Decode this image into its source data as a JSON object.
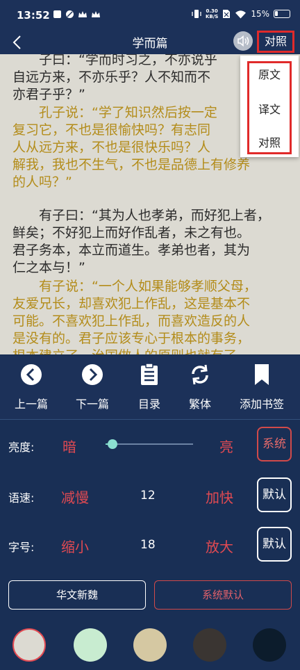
{
  "status": {
    "time": "13:52",
    "net_speed_value": "0.30",
    "net_speed_unit": "KB/S",
    "battery": "15%"
  },
  "header": {
    "title": "学而篇",
    "compare_label": "对照"
  },
  "dropdown": {
    "items": [
      "原文",
      "译文",
      "对照"
    ]
  },
  "content": {
    "passage1_original": [
      "子曰：“学而时习之，不亦说乎",
      "自远方来，不亦乐乎？人不知而不",
      "亦君子乎？”"
    ],
    "passage1_translation": [
      "孔子说：“学了知识然后按一定",
      "复习它，不也是很愉快吗？有志同",
      "人从远方来，不也是很快乐吗？人",
      "解我，我也不生气，不也是品德上有修养",
      "的人吗？”"
    ],
    "passage2_original": [
      "有子曰：“其为人也孝弟，而好犯上者，",
      "鲜矣；不好犯上而好作乱者，未之有也。",
      "君子务本，本立而道生。孝弟也者，其为",
      "仁之本与！”"
    ],
    "passage2_translation": [
      "有子说：“一个人如果能够孝顺父母，",
      "友爱兄长，却喜欢犯上作乱，这是基本不",
      "可能。不喜欢犯上作乱，而喜欢造反的人",
      "是没有的。君子应该专心于根本的事务，",
      "根本建立了，治国做人的原则也就有了"
    ]
  },
  "nav": {
    "prev": "上一篇",
    "next": "下一篇",
    "toc": "目录",
    "traditional": "繁体",
    "bookmark": "添加书签"
  },
  "settings": {
    "brightness": {
      "label": "亮度:",
      "low": "暗",
      "high": "亮",
      "button": "系统",
      "level": 0.08
    },
    "speed": {
      "label": "语速:",
      "dec": "减慢",
      "value": "12",
      "inc": "加快",
      "button": "默认"
    },
    "fontsize": {
      "label": "字号:",
      "dec": "缩小",
      "value": "18",
      "inc": "放大",
      "button": "默认"
    },
    "font_current": "华文新魏",
    "font_default": "系统默认"
  },
  "themes": [
    {
      "name": "light-gray",
      "color": "#dcdad2",
      "selected": true
    },
    {
      "name": "mint",
      "color": "#c8ecd0",
      "selected": false
    },
    {
      "name": "tan",
      "color": "#d5c8a2",
      "selected": false
    },
    {
      "name": "dark-brown",
      "color": "#3a3532",
      "selected": false
    },
    {
      "name": "navy-black",
      "color": "#0c1c2c",
      "selected": false
    }
  ],
  "colors": {
    "panel": "#1c3159",
    "accent_red": "#e14a52",
    "translation_gold": "#b38c1a"
  }
}
